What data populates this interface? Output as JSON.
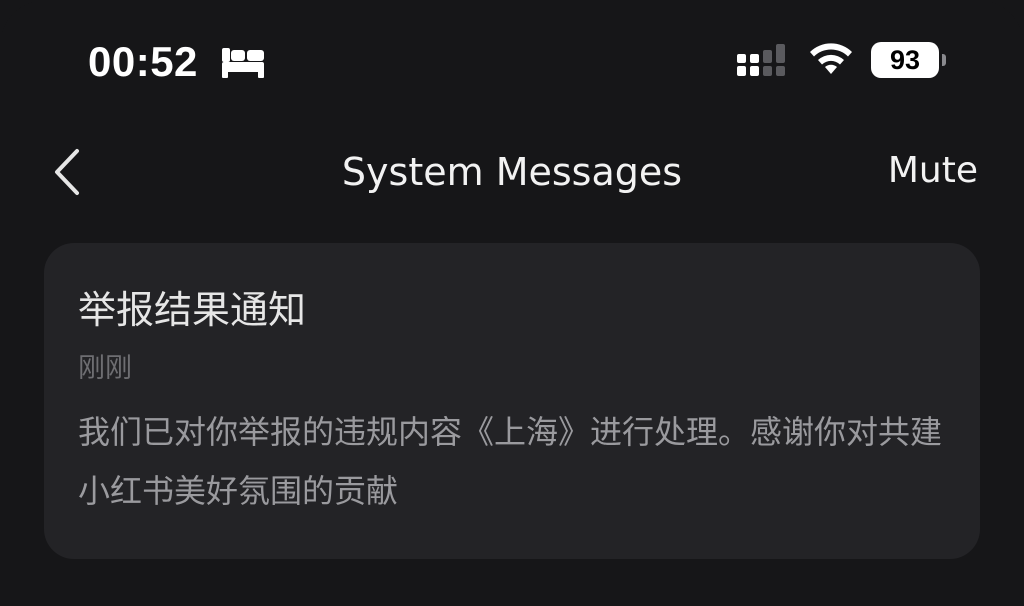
{
  "status_bar": {
    "time": "00:52",
    "focus_icon": "bed-icon",
    "signal_icon": "cellular-signal-icon",
    "wifi_icon": "wifi-icon",
    "battery_level": "93"
  },
  "nav": {
    "back_icon": "chevron-left-icon",
    "title": "System Messages",
    "mute_label": "Mute"
  },
  "message": {
    "title": "举报结果通知",
    "time": "刚刚",
    "body": "我们已对你举报的违规内容《上海》进行处理。感谢你对共建小红书美好氛围的贡献"
  },
  "colors": {
    "background": "#161618",
    "card": "#232326",
    "primary_text": "#f2f2f2",
    "secondary_text": "#9a9a9e"
  }
}
